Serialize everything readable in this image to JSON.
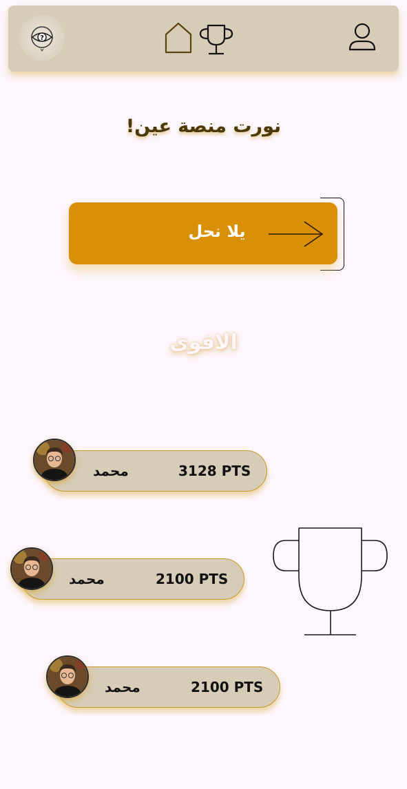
{
  "nav": {
    "logo_icon": "eye-question-icon",
    "home_icon": "home-icon",
    "trophy_icon": "trophy-icon",
    "profile_icon": "user-icon"
  },
  "welcome": {
    "text": "نورت منصة عين!"
  },
  "start": {
    "label": "يلا نحل",
    "icon": "arrow-right-icon"
  },
  "ranking": {
    "title": "الاقوى",
    "trophy_icon": "trophy-outline-icon",
    "players": [
      {
        "name": "محمد",
        "points": "3128 PTS"
      },
      {
        "name": "محمد",
        "points": "2100 PTS"
      },
      {
        "name": "محمد",
        "points": "2100 PTS"
      }
    ]
  },
  "colors": {
    "background": "#fdf6fc",
    "navbar": "#d6ccb8",
    "accent": "#d98f06",
    "card_border": "#c89a2a",
    "title_text": "#4b3a07"
  }
}
